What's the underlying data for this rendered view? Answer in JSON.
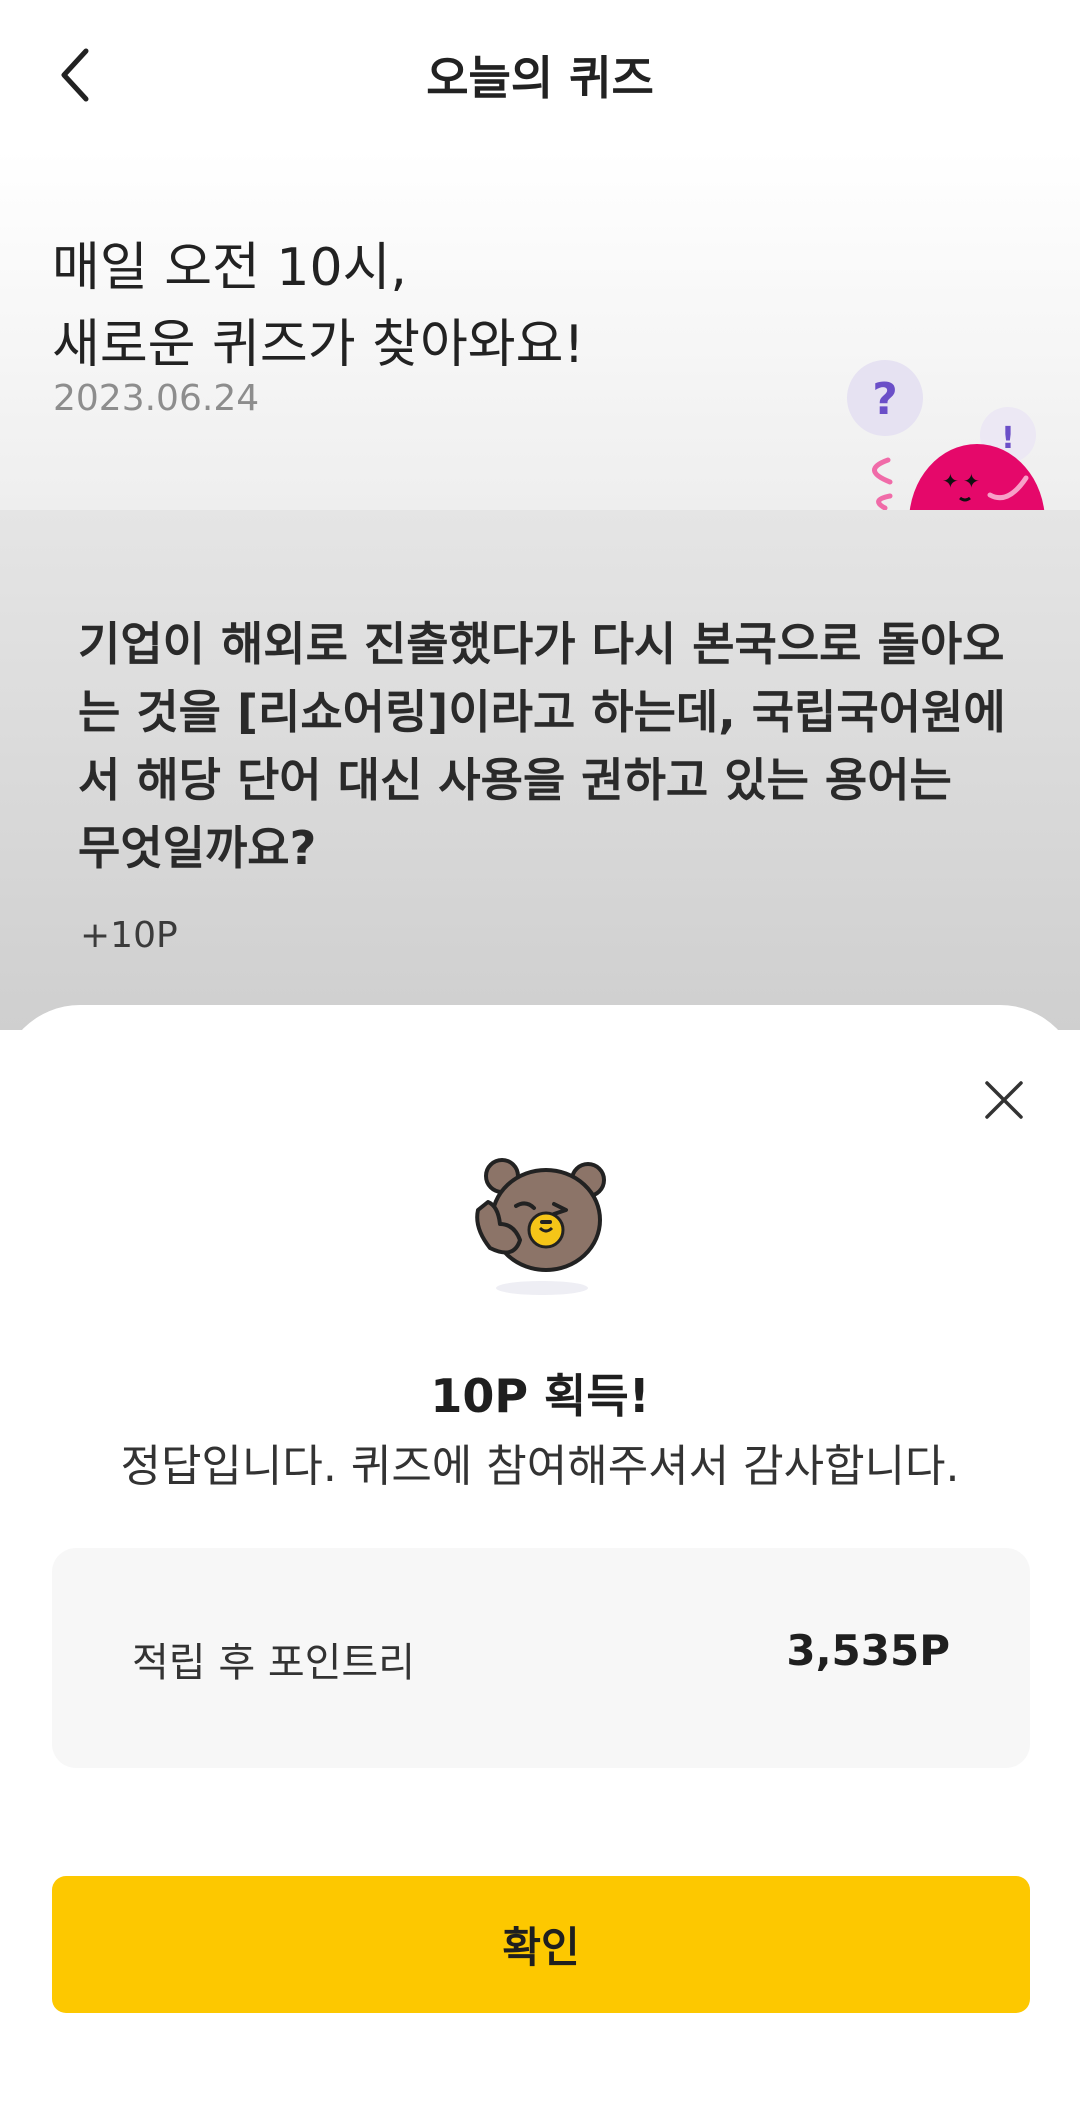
{
  "header": {
    "title": "오늘의 퀴즈",
    "back_icon": "chevron-left-icon"
  },
  "hero": {
    "line1": "매일 오전 10시,",
    "line2": "새로운 퀴즈가 찾아와요!",
    "date": "2023.06.24",
    "mascot_bubble_left": "?",
    "mascot_bubble_right": "!"
  },
  "quiz": {
    "question": "기업이 해외로 진출했다가 다시 본국으로 돌아오는 것을 [리쇼어링]이라고 하는데, 국립국어원에서 해당 단어 대신 사용을 권하고 있는 용어는 무엇일까요?",
    "points": "+10P"
  },
  "result_sheet": {
    "close_icon": "close-icon",
    "title": "10P 획득!",
    "message": "정답입니다. 퀴즈에 참여해주셔서 감사합니다.",
    "summary_label": "적립 후 포인트리",
    "summary_value": "3,535P",
    "confirm_label": "확인"
  },
  "colors": {
    "accent": "#FDC800",
    "mascot_pink": "#E5086A",
    "bubble_purple": "#6B4FC8",
    "bear_brown": "#8C7468"
  }
}
